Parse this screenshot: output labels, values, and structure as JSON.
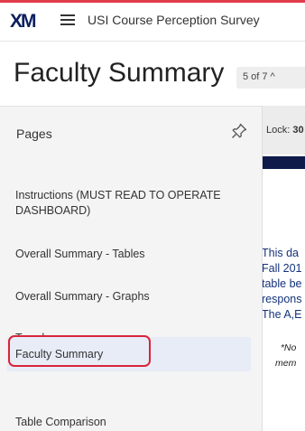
{
  "app": {
    "logo": "XM",
    "survey_title": "USI Course Perception Survey",
    "colors": {
      "accent": "#e23b4a",
      "navy": "#0d1a4a",
      "active_bg": "#e8ecf7",
      "link_text": "#13327a"
    }
  },
  "header": {
    "page_title": "Faculty Summary",
    "pager": "5 of 7",
    "pager_icon": "chevron-up-icon"
  },
  "sidebar": {
    "title": "Pages",
    "pin_icon": "pin-icon",
    "items": [
      {
        "label": "Instructions (MUST READ TO OPERATE DASHBOARD)",
        "active": false
      },
      {
        "label": "Overall Summary - Tables",
        "active": false
      },
      {
        "label": "Overall Summary - Graphs",
        "active": false
      },
      {
        "label": "Trends",
        "active": false
      },
      {
        "label": "Faculty Summary",
        "active": true
      },
      {
        "label": "Table Comparison",
        "active": false
      }
    ]
  },
  "content": {
    "lock_label": "Lock:",
    "lock_value": "30",
    "body_lines": [
      "This da",
      "Fall 201",
      "table be",
      "respons",
      "The A,E"
    ],
    "note_lines": [
      "*No",
      "mem"
    ]
  }
}
